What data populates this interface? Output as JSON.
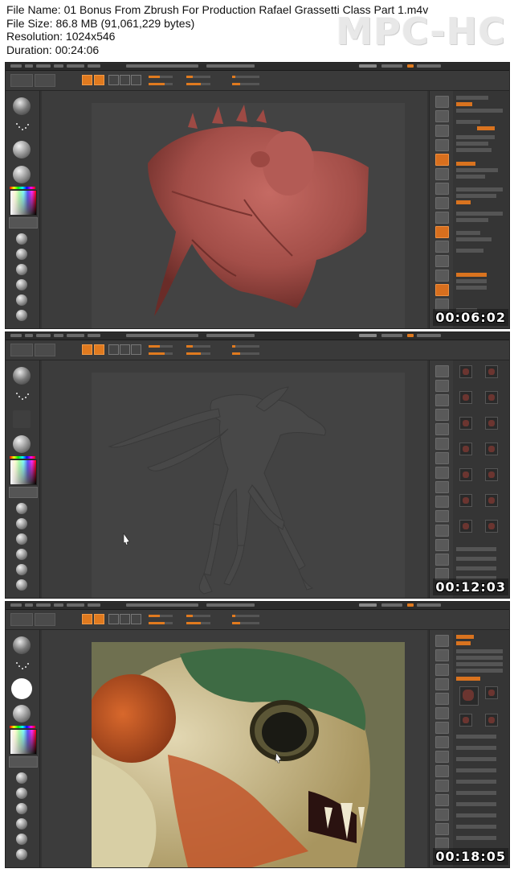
{
  "file_info": {
    "file_name": "File Name: 01 Bonus From Zbrush For Production Rafael Grassetti Class Part 1.m4v",
    "file_size": "File Size: 86.8 MB (91,061,229 bytes)",
    "resolution": "Resolution: 1024x546",
    "duration": "Duration: 00:24:06"
  },
  "player_logo": "MPC-HC",
  "frames": [
    {
      "timestamp": "00:06:02",
      "model": "red-sculpted-creature-head",
      "model_color": "#a5524d"
    },
    {
      "timestamp": "00:12:03",
      "model": "gray-insectoid-creature-full-body",
      "model_color": "#4a4a4a"
    },
    {
      "timestamp": "00:18:05",
      "model": "painted-creature-head-closeup",
      "model_color": "#c9b88a"
    }
  ],
  "colors": {
    "ui_background": "#333333",
    "accent": "#e07a1f",
    "page_background": "#ffffff"
  }
}
